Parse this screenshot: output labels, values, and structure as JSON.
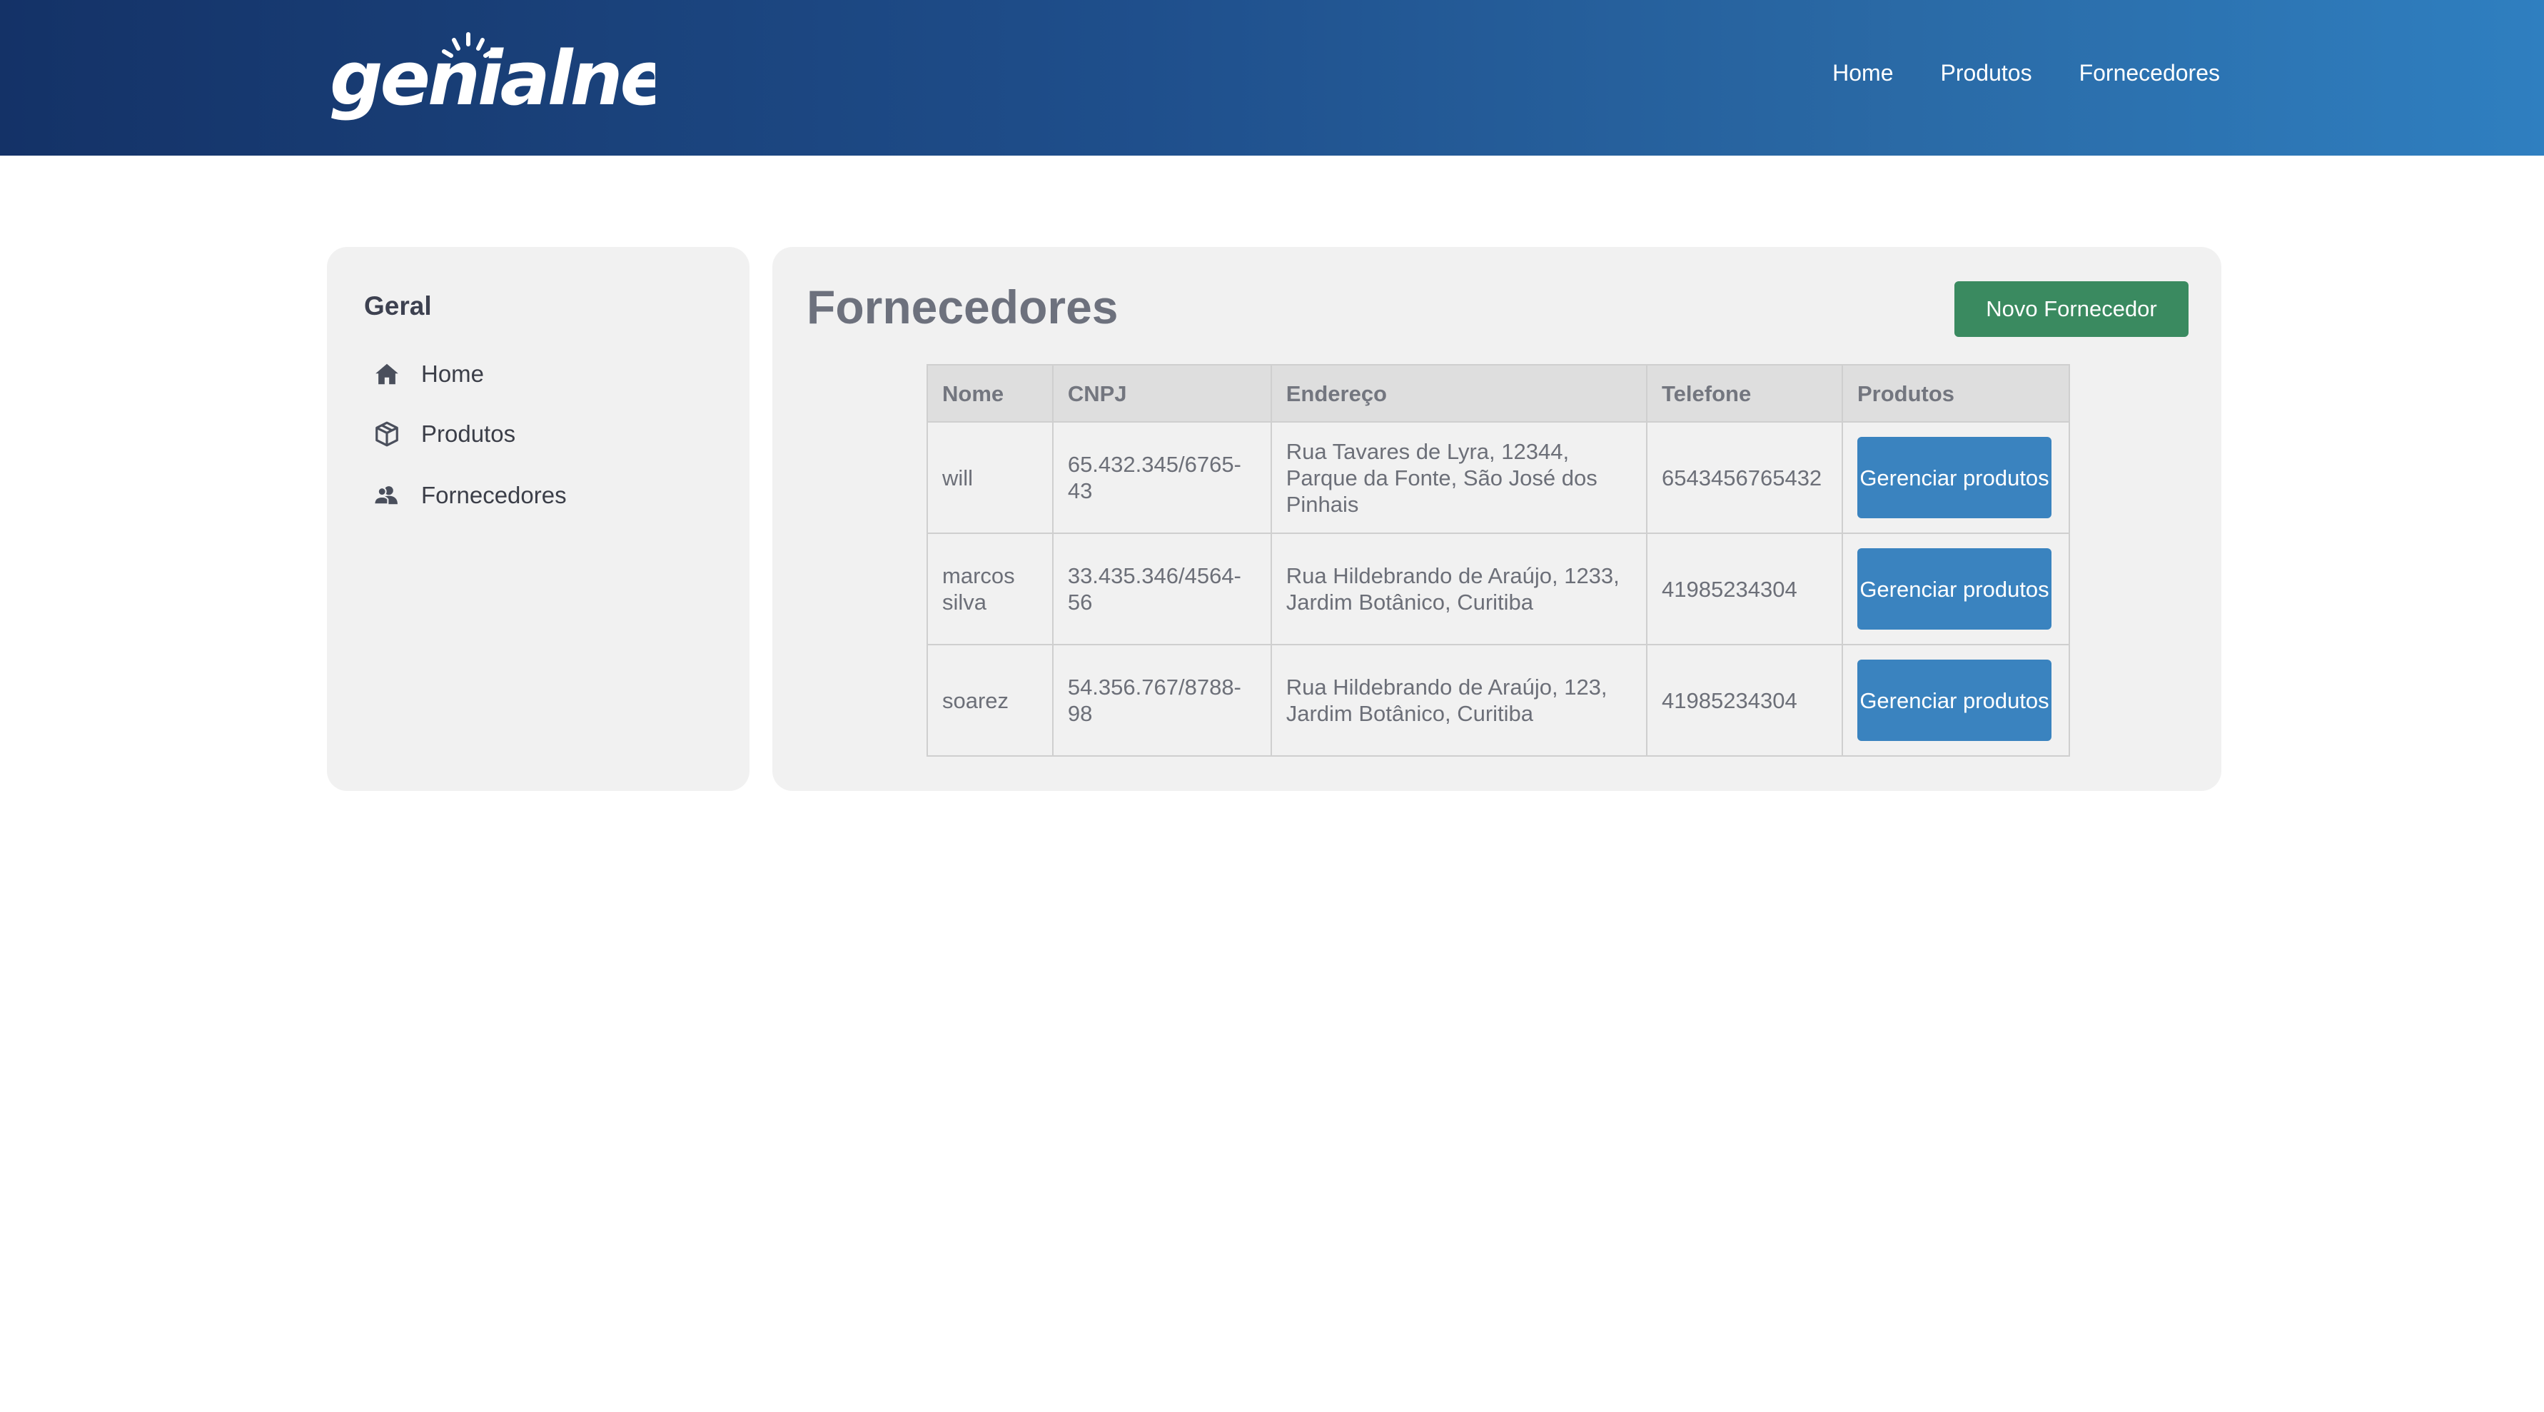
{
  "brand": {
    "logo_text": "genialnet"
  },
  "topnav": {
    "items": [
      {
        "label": "Home"
      },
      {
        "label": "Produtos"
      },
      {
        "label": "Fornecedores"
      }
    ]
  },
  "sidebar": {
    "title": "Geral",
    "items": [
      {
        "label": "Home",
        "icon": "home-icon"
      },
      {
        "label": "Produtos",
        "icon": "box-icon"
      },
      {
        "label": "Fornecedores",
        "icon": "users-icon"
      }
    ]
  },
  "main": {
    "title": "Fornecedores",
    "new_button_label": "Novo Fornecedor",
    "table": {
      "headers": [
        "Nome",
        "CNPJ",
        "Endereço",
        "Telefone",
        "Produtos"
      ],
      "rows": [
        {
          "nome": "will",
          "cnpj": "65.432.345/6765-43",
          "endereco": "Rua Tavares de Lyra, 12344, Parque da Fonte, São José dos Pinhais",
          "telefone": "6543456765432",
          "action": "Gerenciar produtos"
        },
        {
          "nome": "marcos silva",
          "cnpj": "33.435.346/4564-56",
          "endereco": "Rua Hildebrando de Araújo, 1233, Jardim Botânico, Curitiba",
          "telefone": "41985234304",
          "action": "Gerenciar produtos"
        },
        {
          "nome": "soarez",
          "cnpj": "54.356.767/8788-98",
          "endereco": "Rua Hildebrando de Araújo, 123, Jardim Botânico, Curitiba",
          "telefone": "41985234304",
          "action": "Gerenciar produtos"
        }
      ]
    }
  },
  "colors": {
    "header_start": "#143267",
    "header_end": "#2f7fc0",
    "primary_button": "#3a83bf",
    "success_button": "#3a8a60",
    "panel_bg": "#f1f1f1"
  }
}
